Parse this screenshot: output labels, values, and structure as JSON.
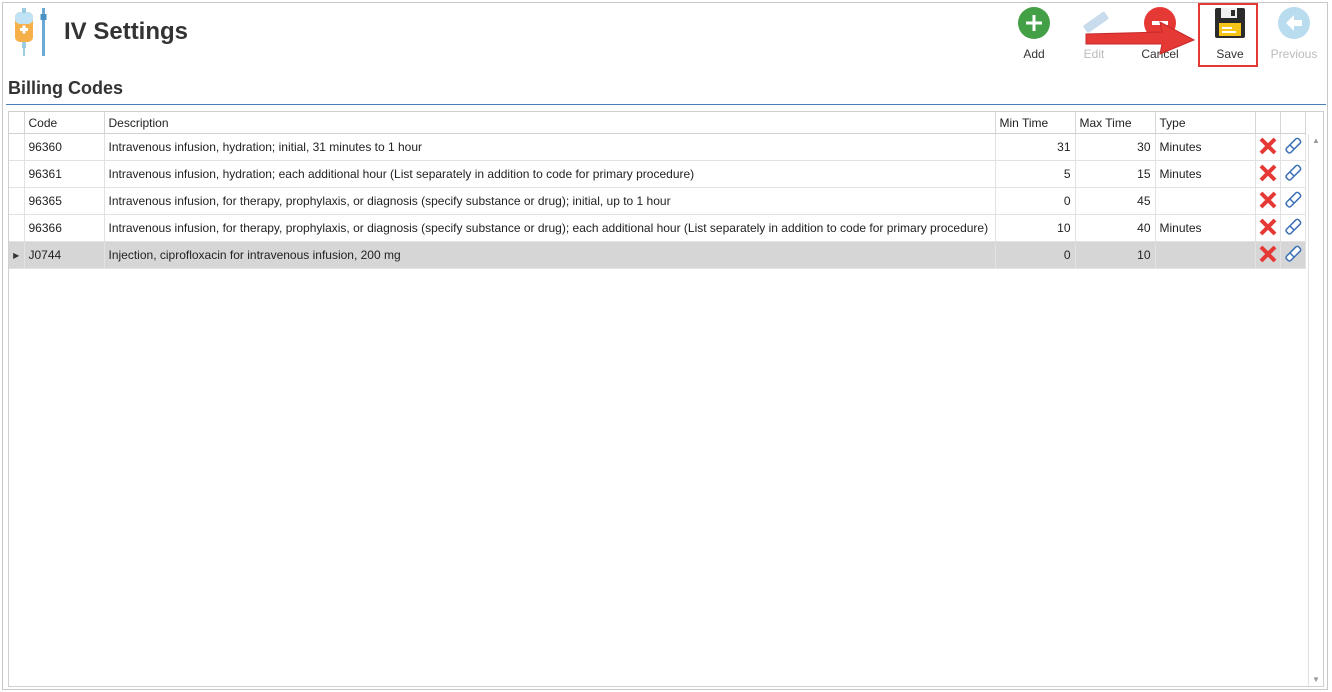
{
  "header": {
    "title": "IV Settings",
    "app_icon": "iv-bag-icon"
  },
  "toolbar": {
    "add_label": "Add",
    "edit_label": "Edit",
    "cancel_label": "Cancel",
    "save_label": "Save",
    "previous_label": "Previous"
  },
  "section": {
    "title": "Billing Codes"
  },
  "grid": {
    "columns": {
      "code": "Code",
      "description": "Description",
      "min_time": "Min Time",
      "max_time": "Max Time",
      "type": "Type"
    },
    "rows": [
      {
        "code": "96360",
        "description": "Intravenous infusion, hydration; initial, 31 minutes to 1 hour",
        "min_time": "31",
        "max_time": "30",
        "type": "Minutes"
      },
      {
        "code": "96361",
        "description": "Intravenous infusion, hydration; each additional hour (List separately in addition to code for primary procedure)",
        "min_time": "5",
        "max_time": "15",
        "type": "Minutes"
      },
      {
        "code": "96365",
        "description": "Intravenous infusion, for therapy, prophylaxis, or diagnosis (specify substance or drug); initial, up to 1 hour",
        "min_time": "0",
        "max_time": "45",
        "type": ""
      },
      {
        "code": "96366",
        "description": "Intravenous infusion, for therapy, prophylaxis, or diagnosis (specify substance or drug); each additional hour (List separately in addition to code for primary procedure)",
        "min_time": "10",
        "max_time": "40",
        "type": "Minutes"
      },
      {
        "code": "J0744",
        "description": "Injection, ciprofloxacin for intravenous infusion, 200 mg",
        "min_time": "0",
        "max_time": "10",
        "type": ""
      }
    ]
  },
  "colors": {
    "accent": "#4a7fb5",
    "add_green": "#43a047",
    "cancel_red": "#e53935",
    "highlight": "#e53935"
  }
}
